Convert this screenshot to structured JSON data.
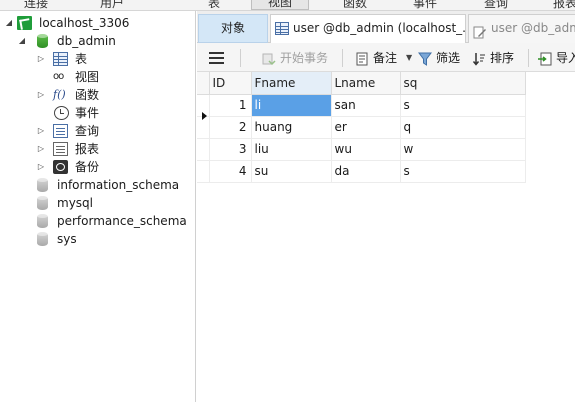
{
  "topbar": {
    "items": [
      "连接",
      "用户",
      "表",
      "视图",
      "函数",
      "事件",
      "查询",
      "报表"
    ]
  },
  "sidebar": {
    "connection": "localhost_3306",
    "database": "db_admin",
    "nodes": {
      "tables": "表",
      "views": "视图",
      "functions": "函数",
      "events": "事件",
      "queries": "查询",
      "reports": "报表",
      "backups": "备份"
    },
    "other_databases": [
      "information_schema",
      "mysql",
      "performance_schema",
      "sys"
    ]
  },
  "tabs": {
    "objects": "对象",
    "tab1": "user @db_admin (localhost_...",
    "tab2": "user @db_adm"
  },
  "toolbar": {
    "begin_transaction": "开始事务",
    "memo": "备注",
    "filter": "筛选",
    "sort": "排序",
    "import": "导入"
  },
  "grid": {
    "columns": [
      "ID",
      "Fname",
      "Lname",
      "sq"
    ],
    "rows": [
      {
        "id": "1",
        "fname": "li",
        "lname": "san",
        "sq": "s"
      },
      {
        "id": "2",
        "fname": "huang",
        "lname": "er",
        "sq": "q"
      },
      {
        "id": "3",
        "fname": "liu",
        "lname": "wu",
        "sq": "w"
      },
      {
        "id": "4",
        "fname": "su",
        "lname": "da",
        "sq": "s"
      }
    ]
  },
  "colors": {
    "selection": "#5aa0e6",
    "objects_tab": "#d4e7f7",
    "connection_icon": "#1f9d3a"
  }
}
